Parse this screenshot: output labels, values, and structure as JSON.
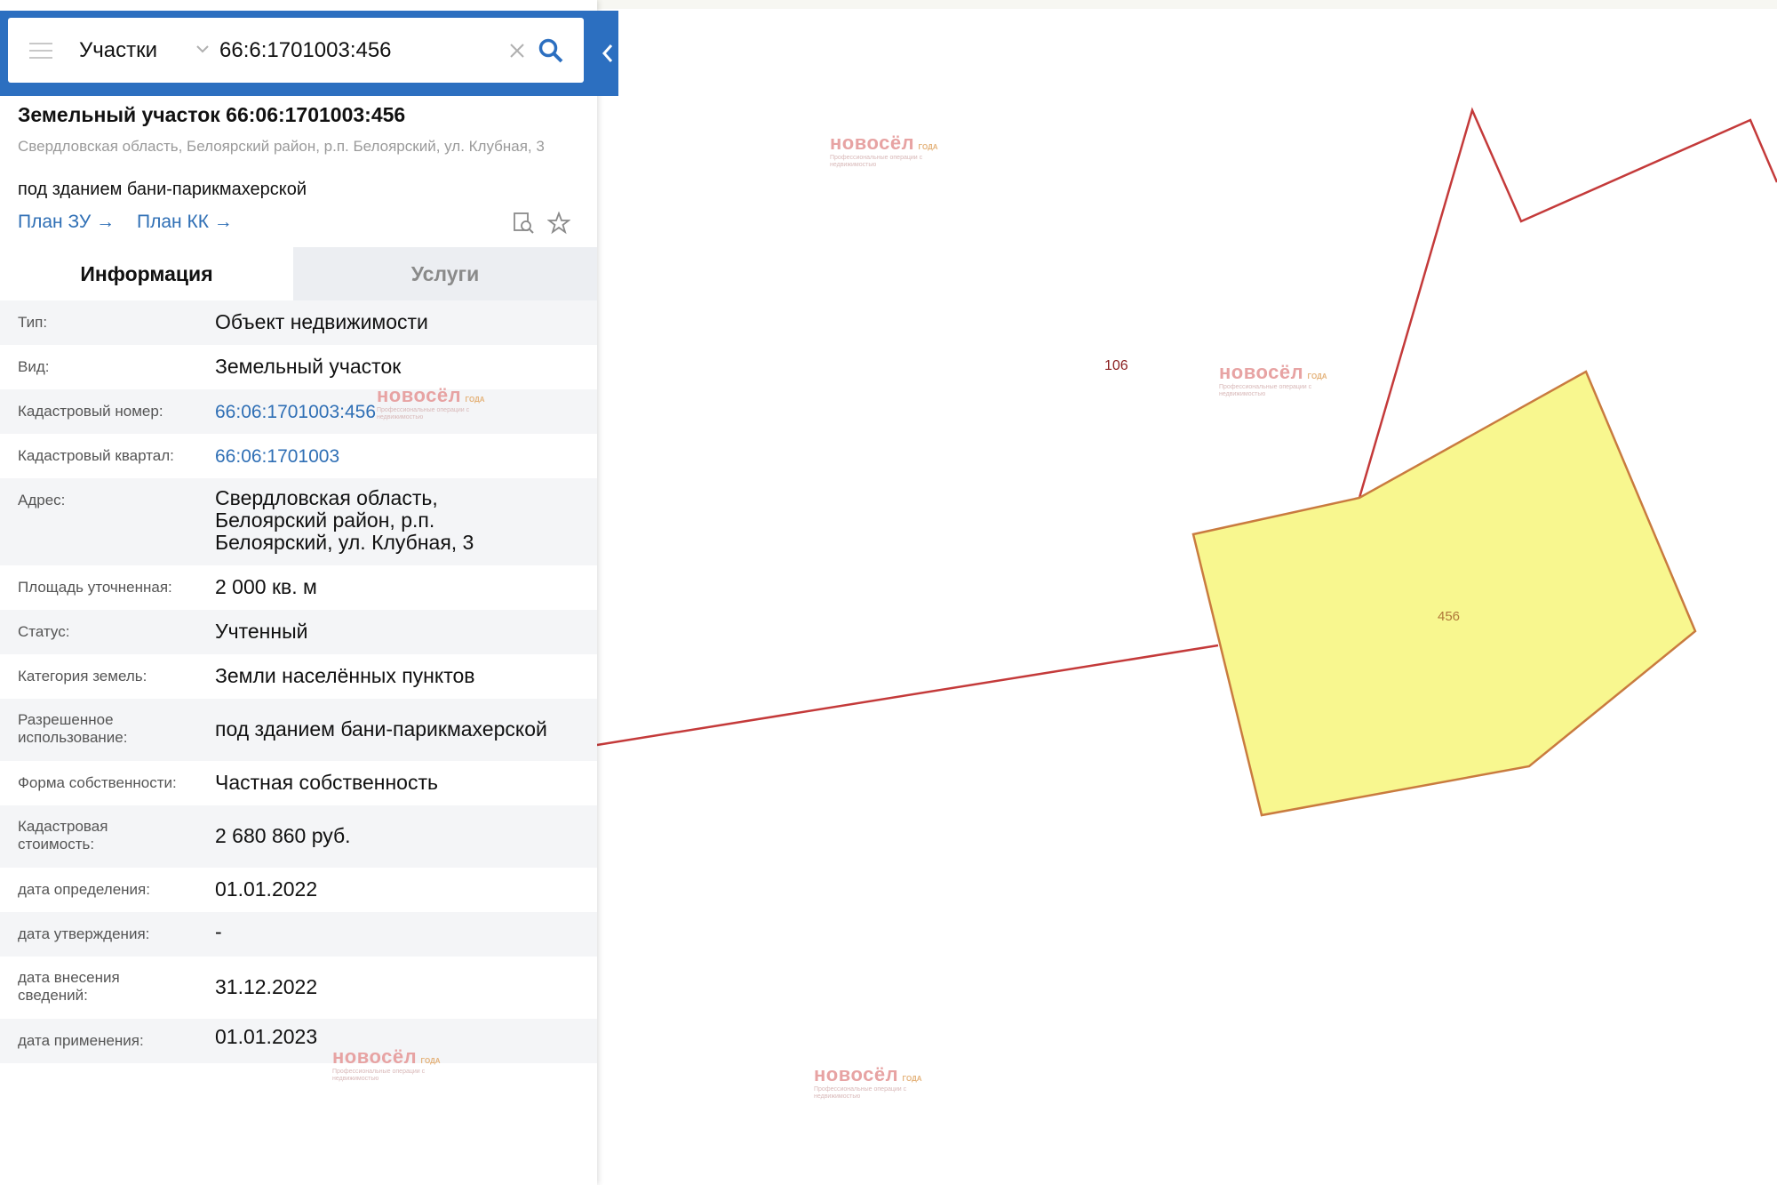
{
  "search": {
    "layer": "Участки",
    "value": "66:6:1701003:456"
  },
  "object": {
    "title": "Земельный участок 66:06:1701003:456",
    "address": "Свердловская область, Белоярский район, р.п. Белоярский, ул. Клубная, 3",
    "purpose": "под зданием бани-парикмахерской",
    "links": [
      "План ЗУ",
      "План КК"
    ]
  },
  "tabs": {
    "info": "Информация",
    "services": "Услуги"
  },
  "rows": [
    {
      "label": "Тип:",
      "value": "Объект недвижимости"
    },
    {
      "label": "Вид:",
      "value": "Земельный участок"
    },
    {
      "label": "Кадастровый номер:",
      "value": "66:06:1701003:456"
    },
    {
      "label": "Кадастровый квартал:",
      "value": "66:06:1701003"
    },
    {
      "label": "Адрес:",
      "value": "Свердловская область, Белоярский район, р.п. Белоярский, ул. Клубная, 3"
    },
    {
      "label": "Площадь уточненная:",
      "value": "2 000 кв. м"
    },
    {
      "label": "Статус:",
      "value": "Учтенный"
    },
    {
      "label": "Категория земель:",
      "value": "Земли населённых пунктов"
    },
    {
      "label": "Разрешенное использование:",
      "value": "под зданием бани-парикмахерской"
    },
    {
      "label": "Форма собственности:",
      "value": "Частная собственность"
    },
    {
      "label": "Кадастровая стоимость:",
      "value": "2 680 860 руб."
    },
    {
      "label": "дата определения:",
      "value": "01.01.2022"
    },
    {
      "label": "дата утверждения:",
      "value": "-"
    },
    {
      "label": "дата внесения сведений:",
      "value": "31.12.2022"
    },
    {
      "label": "дата применения:",
      "value": "01.01.2023"
    }
  ],
  "map": {
    "labels": [
      "106",
      "456"
    ],
    "parcel_fill": "#f8f78f",
    "border_color": "#c43a3a"
  },
  "watermark": {
    "brand": "новосёл",
    "tagline": "Профессиональные операции с недвижимостью",
    "goda": "ГОДА"
  }
}
